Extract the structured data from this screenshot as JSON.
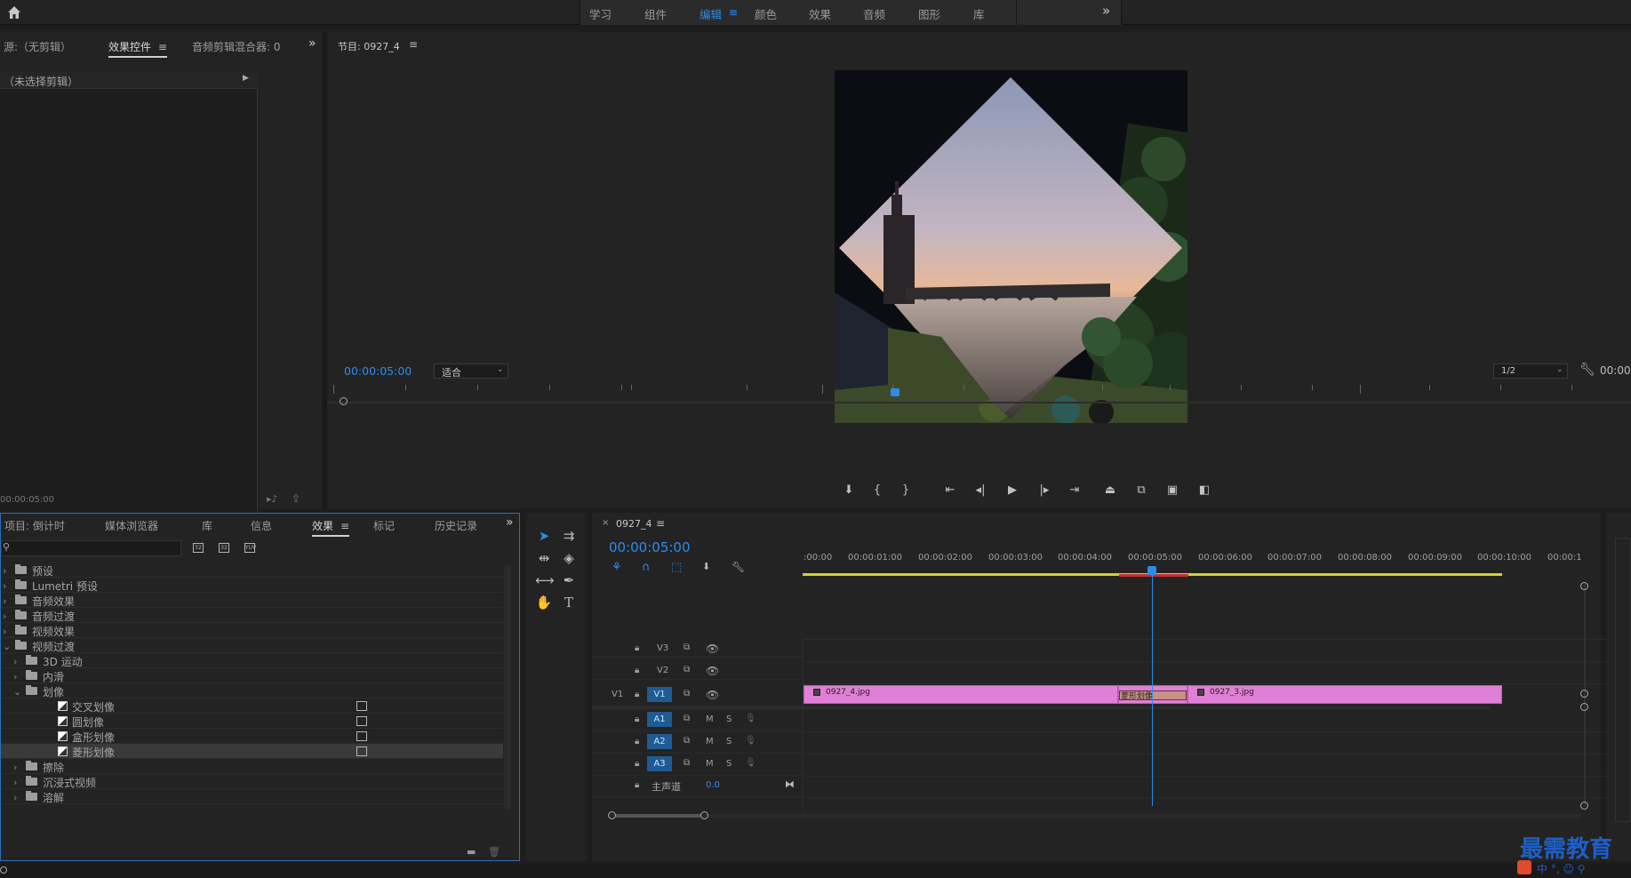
{
  "workspaces": {
    "items": [
      "学习",
      "组件",
      "编辑",
      "颜色",
      "效果",
      "音频",
      "图形",
      "库"
    ],
    "active_index": 2,
    "more": "»"
  },
  "source_panel": {
    "tabs": [
      "源:（无剪辑）",
      "效果控件",
      "音频剪辑混合器: 0"
    ],
    "active_index": 1,
    "no_clip": "（未选择剪辑）",
    "timecode": "00:00:05:00",
    "more": "»"
  },
  "program": {
    "title": "节目: 0927_4",
    "timecode": "00:00:05:00",
    "fit": "适合",
    "resolution": "1/2",
    "timecode_right": "00:00"
  },
  "project_panel": {
    "tabs": [
      "项目: 倒计时",
      "媒体浏览器",
      "库",
      "信息",
      "效果",
      "标记",
      "历史记录"
    ],
    "active_index": 4,
    "more": "»"
  },
  "effects_tree": [
    {
      "label": "预设",
      "level": 0,
      "chev": "›",
      "type": "folder"
    },
    {
      "label": "Lumetri 预设",
      "level": 0,
      "chev": "›",
      "type": "folder"
    },
    {
      "label": "音频效果",
      "level": 0,
      "chev": "›",
      "type": "folder"
    },
    {
      "label": "音频过渡",
      "level": 0,
      "chev": "›",
      "type": "folder"
    },
    {
      "label": "视频效果",
      "level": 0,
      "chev": "›",
      "type": "folder"
    },
    {
      "label": "视频过渡",
      "level": 0,
      "chev": "⌄",
      "type": "folder"
    },
    {
      "label": "3D 运动",
      "level": 1,
      "chev": "›",
      "type": "folder"
    },
    {
      "label": "内滑",
      "level": 1,
      "chev": "›",
      "type": "folder"
    },
    {
      "label": "划像",
      "level": 1,
      "chev": "⌄",
      "type": "folder"
    },
    {
      "label": "交叉划像",
      "level": 2,
      "type": "effect"
    },
    {
      "label": "圆划像",
      "level": 2,
      "type": "effect"
    },
    {
      "label": "盒形划像",
      "level": 2,
      "type": "effect"
    },
    {
      "label": "菱形划像",
      "level": 2,
      "type": "effect",
      "selected": true
    },
    {
      "label": "擦除",
      "level": 1,
      "chev": "›",
      "type": "folder"
    },
    {
      "label": "沉浸式视频",
      "level": 1,
      "chev": "›",
      "type": "folder"
    },
    {
      "label": "溶解",
      "level": 1,
      "chev": "›",
      "type": "folder"
    }
  ],
  "timeline": {
    "sequence": "0927_4",
    "timecode": "00:00:05:00",
    "ruler": [
      ":00:00",
      "00:00:01:00",
      "00:00:02:00",
      "00:00:03:00",
      "00:00:04:00",
      "00:00:05:00",
      "00:00:06:00",
      "00:00:07:00",
      "00:00:08:00",
      "00:00:09:00",
      "00:00:10:00",
      "00:00:1"
    ],
    "tracks": {
      "v3": "V3",
      "v2": "V2",
      "v1_src": "V1",
      "v1": "V1",
      "a1": "A1",
      "a2": "A2",
      "a3": "A3",
      "m": "M",
      "s": "S",
      "master": "主声道",
      "master_val": "0.0"
    },
    "clips": {
      "clip1": "0927_4.jpg",
      "transition": "菱形划像",
      "clip2": "0927_3.jpg"
    }
  },
  "watermark": {
    "title": "最需教育",
    "sub": "中 °, ☺ ⚲"
  },
  "colors": {
    "accent": "#2d8ceb",
    "clip": "#e07fd6",
    "transition": "#c99085"
  }
}
